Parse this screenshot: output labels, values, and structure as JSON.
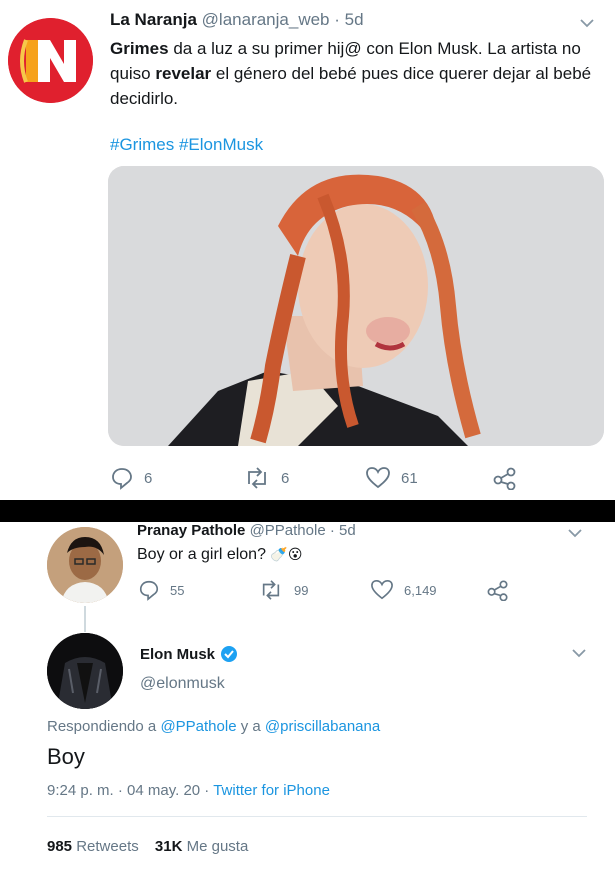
{
  "tweet1": {
    "name": "La Naranja",
    "handle": "@lanaranja_web",
    "separator": "·",
    "time": "5d",
    "avatar_letter": "N",
    "text_bold1": "Grimes",
    "text_part1": " da a luz a su primer hij@ con Elon Musk. La artista no quiso ",
    "text_bold2": "revelar",
    "text_part2": " el género del bebé pues dice querer dejar al bebé decidirlo.",
    "hashtag1": "#Grimes",
    "hashtag2": "#ElonMusk",
    "replies": "6",
    "retweets": "6",
    "likes": "61"
  },
  "tweet2": {
    "name": "Pranay Pathole",
    "handle": "@PPathole",
    "separator": "·",
    "time": "5d",
    "text": "Boy or a girl elon?",
    "emoji": "🍼😮",
    "replies": "55",
    "retweets": "99",
    "likes": "6,149"
  },
  "tweet3": {
    "name": "Elon Musk",
    "handle": "@elonmusk",
    "reply_prefix": "Respondiendo a ",
    "reply_user1": "@PPathole",
    "reply_and": " y a ",
    "reply_user2": "@priscillabanana",
    "text": "Boy",
    "time": "9:24 p. m. · 04 may. 20 · ",
    "source": "Twitter for iPhone",
    "retweets_count": "985",
    "retweets_label": "Retweets",
    "likes_count": "31K",
    "likes_label": "Me gusta"
  },
  "colors": {
    "link": "#1b95e0",
    "muted": "#657786",
    "brand_red": "#e0202e",
    "verified": "#1da1f2"
  },
  "icons": [
    "reply-icon",
    "retweet-icon",
    "like-icon",
    "share-icon",
    "chevron-down-icon",
    "verified-badge-icon"
  ]
}
